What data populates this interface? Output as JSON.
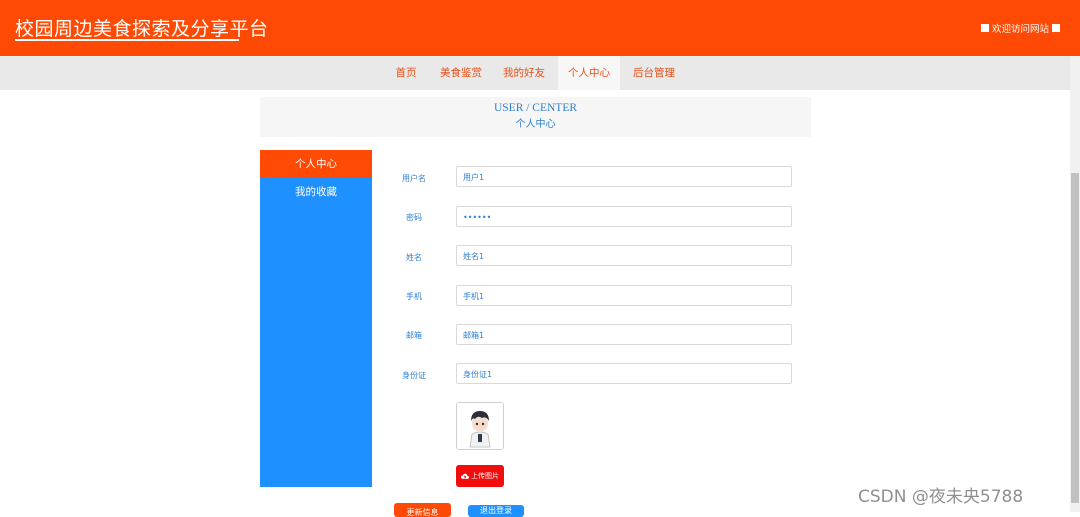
{
  "header": {
    "site_title": "校园周边美食探索及分享平台",
    "welcome_text": "欢迎访问网站"
  },
  "nav": {
    "items": [
      {
        "label": "首页"
      },
      {
        "label": "美食鉴赏"
      },
      {
        "label": "我的好友"
      },
      {
        "label": "个人中心",
        "active": true
      },
      {
        "label": "后台管理"
      }
    ]
  },
  "banner": {
    "title_en": "USER / CENTER",
    "title_zh": "个人中心"
  },
  "sidebar": {
    "items": [
      {
        "label": "个人中心",
        "active": true
      },
      {
        "label": "我的收藏"
      }
    ]
  },
  "form": {
    "fields": [
      {
        "label": "用户名",
        "value": "用户1"
      },
      {
        "label": "密码",
        "value": "••••••"
      },
      {
        "label": "姓名",
        "value": "姓名1"
      },
      {
        "label": "手机",
        "value": "手机1"
      },
      {
        "label": "邮箱",
        "value": "邮箱1"
      },
      {
        "label": "身份证",
        "value": "身份证1"
      }
    ],
    "upload_label": "上传图片",
    "save_label": "更新信息",
    "logout_label": "退出登录"
  },
  "watermark": "CSDN @夜未央5788",
  "colors": {
    "primary_orange": "#ff4a05",
    "primary_blue": "#1e90ff",
    "upload_red": "#f20d0d"
  }
}
